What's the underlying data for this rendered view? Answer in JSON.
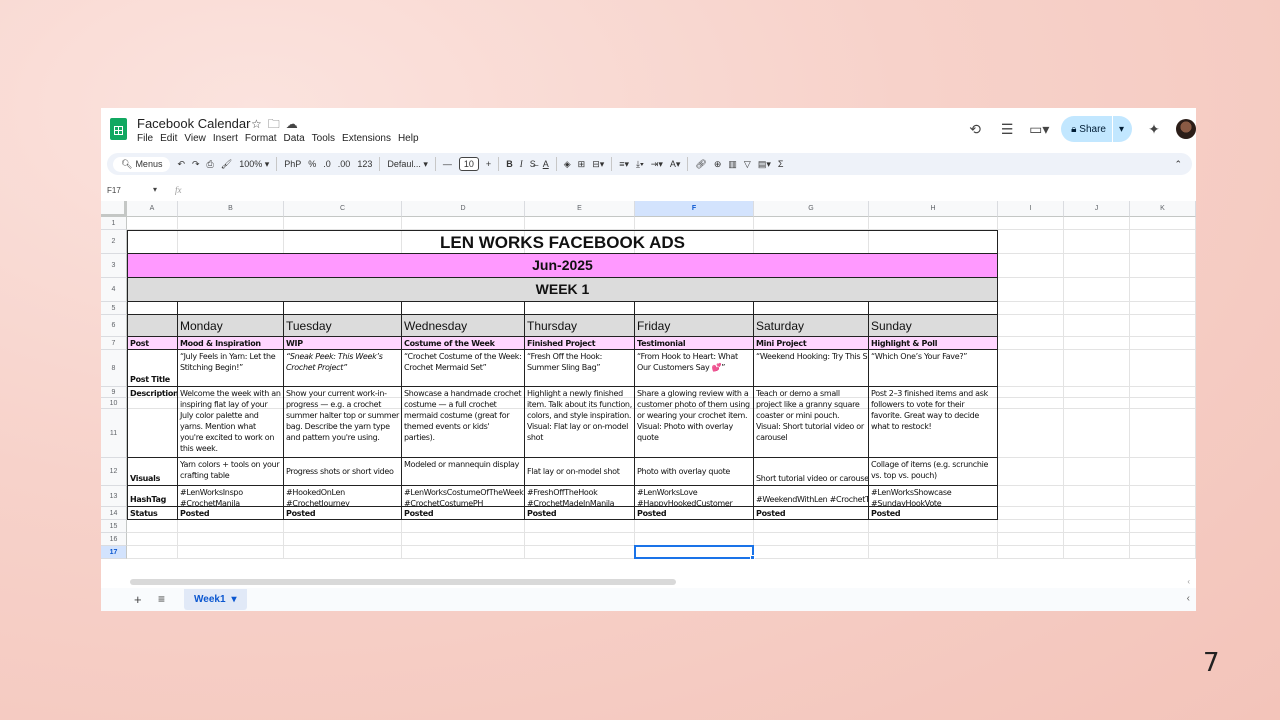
{
  "app": {
    "title": "Facebook Calendar",
    "menu": [
      "File",
      "Edit",
      "View",
      "Insert",
      "Format",
      "Data",
      "Tools",
      "Extensions",
      "Help"
    ],
    "share_label": "Share"
  },
  "toolbar": {
    "menus_label": "Menus",
    "zoom": "100%",
    "currency": "PhP",
    "percent": "%",
    "dec_decrease": ".0",
    "dec_increase": ".00",
    "number_format": "123",
    "font": "Defaul...",
    "font_size": "10",
    "bold": "B",
    "italic": "I",
    "text_color": "A"
  },
  "formula_bar": {
    "cell_ref": "F17",
    "fx": "fx"
  },
  "grid": {
    "columns": [
      "A",
      "B",
      "C",
      "D",
      "E",
      "F",
      "G",
      "H",
      "I",
      "J",
      "K"
    ],
    "rows": [
      "1",
      "2",
      "3",
      "4",
      "5",
      "6",
      "7",
      "8",
      "9",
      "10",
      "11",
      "12",
      "13",
      "14",
      "15",
      "16",
      "17"
    ],
    "selected_column": "F",
    "selected_row": "17"
  },
  "sheet": {
    "title": "LEN WORKS FACEBOOK ADS",
    "month": "Jun-2025",
    "week": "WEEK 1",
    "days": [
      "Monday",
      "Tuesday",
      "Wednesday",
      "Thursday",
      "Friday",
      "Saturday",
      "Sunday"
    ],
    "row_labels": {
      "post": "Post",
      "post_title": "Post Title",
      "description": "Description",
      "visuals": "Visuals",
      "hashtag": "HashTag",
      "status": "Status"
    },
    "post_types": [
      "Mood & Inspiration",
      "WIP",
      "Costume of the Week",
      "Finished Project",
      "Testimonial",
      "Mini Project",
      "Highlight & Poll"
    ],
    "post_titles": [
      "“July Feels in Yarn: Let the Stitching Begin!”",
      "“Sneak Peek: This Week’s Crochet Project”",
      "“Crochet Costume of the Week: Crochet Mermaid Set”",
      "“Fresh Off the Hook: Summer Sling Bag”",
      "“From Hook to Heart: What Our Customers Say 💕”",
      "“Weekend Hooking: Try This Simple Granny Square”",
      "“Which One’s Your Fave?”"
    ],
    "descriptions": [
      "Welcome the week with an inspiring flat lay of your July color palette and yarns. Mention what you're excited to work on this week.",
      "Show your current work-in-progress — e.g. a crochet summer halter top or summer bag. Describe the yarn type and pattern you're using.",
      "Showcase a handmade crochet costume — a full crochet mermaid costume (great for themed events or kids' parties).",
      "Highlight a newly finished item. Talk about its function, colors, and style inspiration.\n Visual: Flat lay or on-model shot",
      "Share a glowing review with a customer photo of them using or wearing your crochet item.\n Visual: Photo with overlay quote",
      "Teach or demo a small project like a granny square coaster or mini pouch.\n Visual: Short tutorial video or carousel",
      "Post 2–3 finished items and ask followers to vote for their favorite. Great way to decide what to restock!"
    ],
    "visuals": [
      "Yarn colors + tools on your crafting table",
      "Progress shots or short video",
      "Modeled or mannequin display",
      "Flat lay or on-model shot",
      "Photo with overlay quote",
      "Short tutorial video or carousel",
      "Collage of items (e.g. scrunchie vs. top vs. pouch)"
    ],
    "hashtags": [
      "#LenWorksInspo #CrochetManila",
      "#HookedOnLen #CrochetJourney",
      "#LenWorksCostumeOfTheWeek #CrochetCostumePH",
      "#FreshOffTheHook #CrochetMadeInManila",
      "#LenWorksLove #HappyHookedCustomer",
      "#WeekendWithLen #CrochetTutorial",
      "#LenWorksShowcase #SundayHookVote"
    ],
    "statuses": [
      "Posted",
      "Posted",
      "Posted",
      "Posted",
      "Posted",
      "Posted",
      "Posted"
    ]
  },
  "sheet_tabs": {
    "active": "Week1"
  },
  "slide_number": "7",
  "colors": {
    "title_pink": "#ff99ff",
    "light_pink": "#ffd6ff",
    "header_gray": "#dcdcdc",
    "sheets_green": "#11a861",
    "share_blue": "#c2e7ff",
    "selection_blue": "#1a73e8"
  }
}
